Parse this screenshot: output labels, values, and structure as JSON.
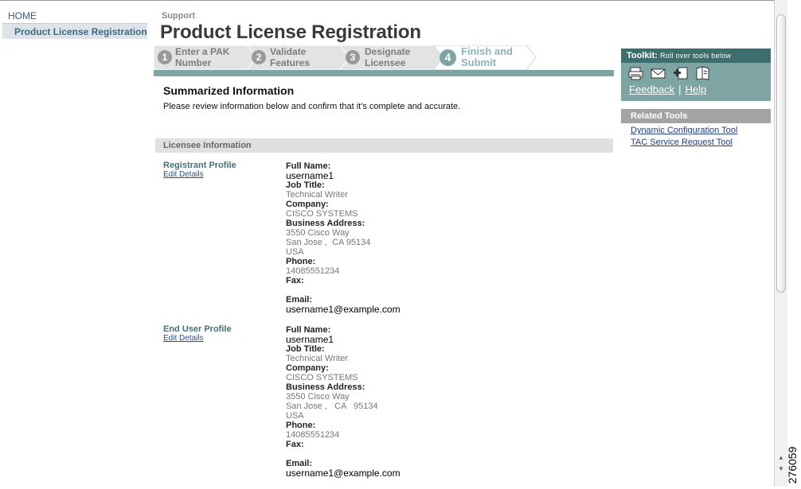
{
  "nav": {
    "home": "HOME",
    "current": "Product License Registration"
  },
  "header": {
    "section": "Support",
    "title": "Product License Registration"
  },
  "steps": [
    {
      "num": "1",
      "line1": "Enter a PAK",
      "line2": "Number",
      "active": false
    },
    {
      "num": "2",
      "line1": "Validate",
      "line2": "Features",
      "active": false
    },
    {
      "num": "3",
      "line1": "Designate",
      "line2": "Licensee",
      "active": false
    },
    {
      "num": "4",
      "line1": "Finish and",
      "line2": "Submit",
      "active": true
    }
  ],
  "summary": {
    "title": "Summarized Information",
    "description": "Please review information below and confirm that it's complete and accurate."
  },
  "licensee": {
    "section_title": "Licensee Information",
    "edit_label": "Edit Details",
    "labels": {
      "full_name": "Full Name:",
      "job_title": "Job Title:",
      "company": "Company:",
      "address": "Business Address:",
      "phone": "Phone:",
      "fax": "Fax:",
      "email": "Email:"
    },
    "profiles": [
      {
        "label": "Registrant Profile",
        "full_name": "username1",
        "job_title": "Technical Writer",
        "company": "CISCO SYSTEMS",
        "address_line1": "3550 Cisco Way",
        "address_line2": "San Jose ,  CA 95134",
        "address_line3": "USA",
        "phone": "14085551234",
        "fax": "",
        "email": "username1@example.com"
      },
      {
        "label": "End User Profile",
        "full_name": "username1",
        "job_title": "Technical Writer",
        "company": "CISCO SYSTEMS",
        "address_line1": "3550 Cisco Way",
        "address_line2": "San Jose ,   CA   95134",
        "address_line3": "USA",
        "phone": "14085551234",
        "fax": "",
        "email": "username1@example.com"
      }
    ]
  },
  "toolkit": {
    "title": "Toolkit:",
    "hint": "Roll over tools below",
    "icons": [
      "print-icon",
      "email-icon",
      "add-bookmark-icon",
      "open-book-icon"
    ],
    "feedback": "Feedback",
    "separator": "|",
    "help": "Help"
  },
  "related": {
    "title": "Related Tools",
    "links": [
      "Dynamic Configuration Tool",
      "TAC Service Request Tool"
    ]
  },
  "figure_number": "276059",
  "colors": {
    "teal": "#7ea4a4",
    "dark_teal": "#3d6e6e",
    "link_blue": "#1f3f82",
    "label_teal": "#44707a"
  }
}
